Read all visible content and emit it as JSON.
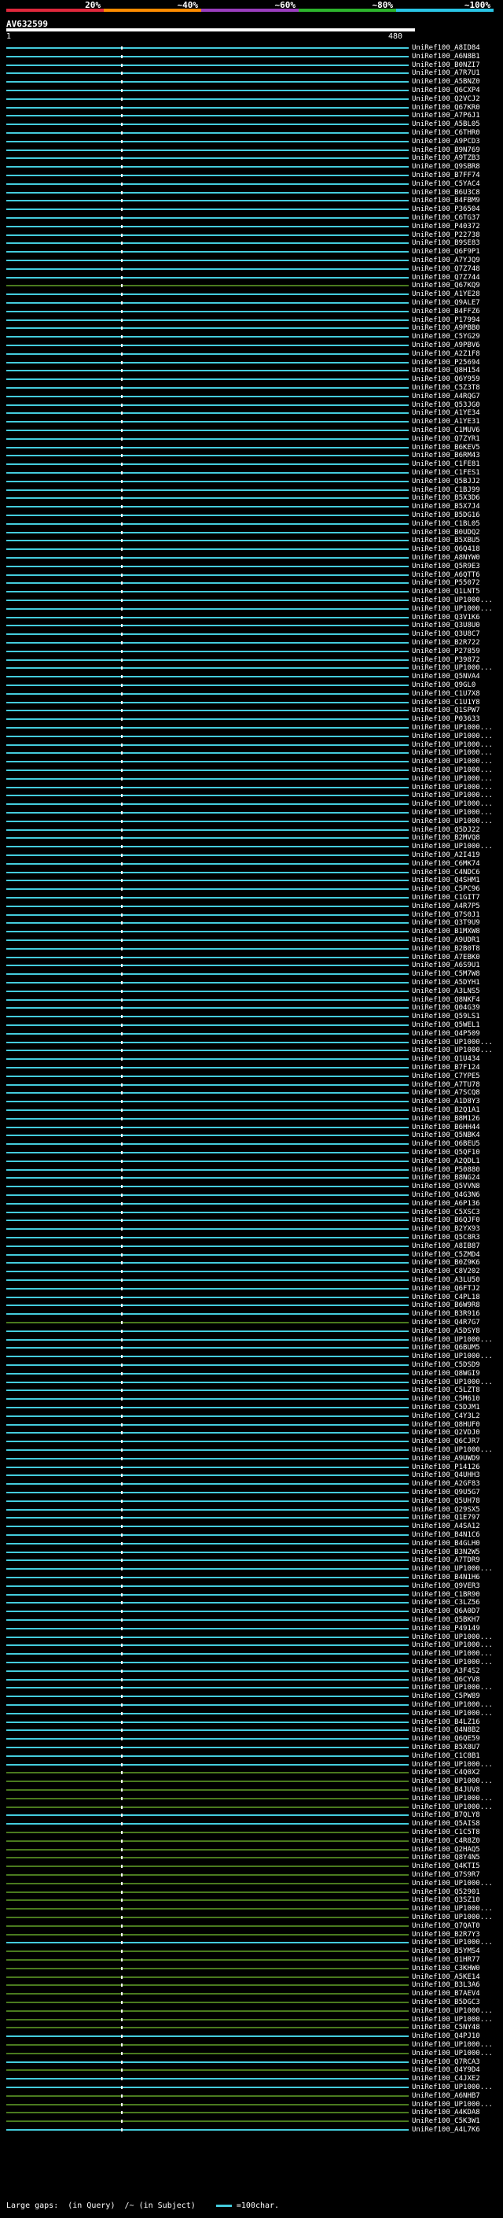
{
  "scale": {
    "ticks": [
      "20%",
      "~40%",
      "~60%",
      "~80%",
      "~100%"
    ],
    "colors": [
      "#e0283c",
      "#ff8c00",
      "#9b3ebf",
      "#2db52d",
      "#29c5e6"
    ]
  },
  "query": {
    "name": "AV632599",
    "start": "1",
    "end": "480"
  },
  "legend": {
    "large_gaps": "Large gaps:",
    "in_query": "(in Query)",
    "in_subject": "/~ (in Subject)",
    "scale_note": "=100char."
  },
  "colors": {
    "cyan": "#44ccdd",
    "green": "#4a7a1e",
    "gap": "#ffffff"
  },
  "hits": [
    {
      "label": "UniRef100_A8ID84",
      "color": "cyan"
    },
    {
      "label": "UniRef100_A6N8B1",
      "color": "cyan"
    },
    {
      "label": "UniRef100_B0NZI7",
      "color": "cyan"
    },
    {
      "label": "UniRef100_A7R7U1",
      "color": "cyan"
    },
    {
      "label": "UniRef100_A5BNZ0",
      "color": "cyan"
    },
    {
      "label": "UniRef100_Q6CXP4",
      "color": "cyan"
    },
    {
      "label": "UniRef100_Q2VCJ2",
      "color": "cyan"
    },
    {
      "label": "UniRef100_Q67KR0",
      "color": "cyan"
    },
    {
      "label": "UniRef100_A7P6J1",
      "color": "cyan"
    },
    {
      "label": "UniRef100_A5BL05",
      "color": "cyan"
    },
    {
      "label": "UniRef100_C6THR0",
      "color": "cyan"
    },
    {
      "label": "UniRef100_A9PCD3",
      "color": "cyan"
    },
    {
      "label": "UniRef100_B9N769",
      "color": "cyan"
    },
    {
      "label": "UniRef100_A9TZB3",
      "color": "cyan"
    },
    {
      "label": "UniRef100_Q9SBR8",
      "color": "cyan"
    },
    {
      "label": "UniRef100_B7FF74",
      "color": "cyan"
    },
    {
      "label": "UniRef100_C5YAC4",
      "color": "cyan"
    },
    {
      "label": "UniRef100_B6U3C8",
      "color": "cyan"
    },
    {
      "label": "UniRef100_B4FBM9",
      "color": "cyan"
    },
    {
      "label": "UniRef100_P36504",
      "color": "cyan"
    },
    {
      "label": "UniRef100_C6TG37",
      "color": "cyan"
    },
    {
      "label": "UniRef100_P40372",
      "color": "cyan"
    },
    {
      "label": "UniRef100_P22738",
      "color": "cyan"
    },
    {
      "label": "UniRef100_B9SE83",
      "color": "cyan"
    },
    {
      "label": "UniRef100_Q6F9P1",
      "color": "cyan"
    },
    {
      "label": "UniRef100_A7YJQ9",
      "color": "cyan"
    },
    {
      "label": "UniRef100_Q7Z748",
      "color": "cyan"
    },
    {
      "label": "UniRef100_Q7Z744",
      "color": "cyan"
    },
    {
      "label": "UniRef100_Q67KQ9",
      "color": "green"
    },
    {
      "label": "UniRef100_A1YE28",
      "color": "cyan"
    },
    {
      "label": "UniRef100_Q9ALE7",
      "color": "cyan"
    },
    {
      "label": "UniRef100_B4FFZ6",
      "color": "cyan"
    },
    {
      "label": "UniRef100_P17994",
      "color": "cyan"
    },
    {
      "label": "UniRef100_A9PBB0",
      "color": "cyan"
    },
    {
      "label": "UniRef100_C5YG29",
      "color": "cyan"
    },
    {
      "label": "UniRef100_A9PBV6",
      "color": "cyan"
    },
    {
      "label": "UniRef100_A2Z1F8",
      "color": "cyan"
    },
    {
      "label": "UniRef100_P25694",
      "color": "cyan"
    },
    {
      "label": "UniRef100_Q8H154",
      "color": "cyan"
    },
    {
      "label": "UniRef100_Q6Y959",
      "color": "cyan"
    },
    {
      "label": "UniRef100_C5Z3T8",
      "color": "cyan"
    },
    {
      "label": "UniRef100_A4RQG7",
      "color": "cyan"
    },
    {
      "label": "UniRef100_Q53JG0",
      "color": "cyan"
    },
    {
      "label": "UniRef100_A1YE34",
      "color": "cyan"
    },
    {
      "label": "UniRef100_A1YE31",
      "color": "cyan"
    },
    {
      "label": "UniRef100_C1MUV6",
      "color": "cyan"
    },
    {
      "label": "UniRef100_Q7ZYR1",
      "color": "cyan"
    },
    {
      "label": "UniRef100_B6KEV5",
      "color": "cyan"
    },
    {
      "label": "UniRef100_B6RM43",
      "color": "cyan"
    },
    {
      "label": "UniRef100_C1FE81",
      "color": "cyan"
    },
    {
      "label": "UniRef100_C1FES1",
      "color": "cyan"
    },
    {
      "label": "UniRef100_Q5BJJ2",
      "color": "cyan"
    },
    {
      "label": "UniRef100_C1BJ99",
      "color": "cyan"
    },
    {
      "label": "UniRef100_B5X3D6",
      "color": "cyan"
    },
    {
      "label": "UniRef100_B5X7J4",
      "color": "cyan"
    },
    {
      "label": "UniRef100_B5DG16",
      "color": "cyan"
    },
    {
      "label": "UniRef100_C1BL05",
      "color": "cyan"
    },
    {
      "label": "UniRef100_B0UDQ2",
      "color": "cyan"
    },
    {
      "label": "UniRef100_B5XBU5",
      "color": "cyan"
    },
    {
      "label": "UniRef100_Q6Q418",
      "color": "cyan"
    },
    {
      "label": "UniRef100_A8NYW0",
      "color": "cyan"
    },
    {
      "label": "UniRef100_Q5R9E3",
      "color": "cyan"
    },
    {
      "label": "UniRef100_A6QTT6",
      "color": "cyan"
    },
    {
      "label": "UniRef100_P55072",
      "color": "cyan"
    },
    {
      "label": "UniRef100_Q1LNT5",
      "color": "cyan"
    },
    {
      "label": "UniRef100_UP1000...",
      "color": "cyan"
    },
    {
      "label": "UniRef100_UP1000...",
      "color": "cyan"
    },
    {
      "label": "UniRef100_Q3V1K6",
      "color": "cyan"
    },
    {
      "label": "UniRef100_Q3U8U0",
      "color": "cyan"
    },
    {
      "label": "UniRef100_Q3U8C7",
      "color": "cyan"
    },
    {
      "label": "UniRef100_B2R722",
      "color": "cyan"
    },
    {
      "label": "UniRef100_P27859",
      "color": "cyan"
    },
    {
      "label": "UniRef100_P39872",
      "color": "cyan"
    },
    {
      "label": "UniRef100_UP1000...",
      "color": "cyan"
    },
    {
      "label": "UniRef100_Q5NVA4",
      "color": "cyan"
    },
    {
      "label": "UniRef100_Q9GL0",
      "color": "cyan"
    },
    {
      "label": "UniRef100_C1U7X8",
      "color": "cyan"
    },
    {
      "label": "UniRef100_C1U1Y8",
      "color": "cyan"
    },
    {
      "label": "UniRef100_Q1SPW7",
      "color": "cyan"
    },
    {
      "label": "UniRef100_P03633",
      "color": "cyan"
    },
    {
      "label": "UniRef100_UP1000...",
      "color": "cyan"
    },
    {
      "label": "UniRef100_UP1000...",
      "color": "cyan"
    },
    {
      "label": "UniRef100_UP1000...",
      "color": "cyan"
    },
    {
      "label": "UniRef100_UP1000...",
      "color": "cyan"
    },
    {
      "label": "UniRef100_UP1000...",
      "color": "cyan"
    },
    {
      "label": "UniRef100_UP1000...",
      "color": "cyan"
    },
    {
      "label": "UniRef100_UP1000...",
      "color": "cyan"
    },
    {
      "label": "UniRef100_UP1000...",
      "color": "cyan"
    },
    {
      "label": "UniRef100_UP1000...",
      "color": "cyan"
    },
    {
      "label": "UniRef100_UP1000...",
      "color": "cyan"
    },
    {
      "label": "UniRef100_UP1000...",
      "color": "cyan"
    },
    {
      "label": "UniRef100_UP1000...",
      "color": "cyan"
    },
    {
      "label": "UniRef100_Q5DJ22",
      "color": "cyan"
    },
    {
      "label": "UniRef100_B2MVQ8",
      "color": "cyan"
    },
    {
      "label": "UniRef100_UP1000...",
      "color": "cyan"
    },
    {
      "label": "UniRef100_A2I419",
      "color": "cyan"
    },
    {
      "label": "UniRef100_C6MK74",
      "color": "cyan"
    },
    {
      "label": "UniRef100_C4NDC6",
      "color": "cyan"
    },
    {
      "label": "UniRef100_Q4SHM1",
      "color": "cyan"
    },
    {
      "label": "UniRef100_C5PC96",
      "color": "cyan"
    },
    {
      "label": "UniRef100_C1GIT7",
      "color": "cyan"
    },
    {
      "label": "UniRef100_A4R7P5",
      "color": "cyan"
    },
    {
      "label": "UniRef100_Q7S0J1",
      "color": "cyan"
    },
    {
      "label": "UniRef100_Q3T9U9",
      "color": "cyan"
    },
    {
      "label": "UniRef100_B1MXW8",
      "color": "cyan"
    },
    {
      "label": "UniRef100_A9UDR1",
      "color": "cyan"
    },
    {
      "label": "UniRef100_B2B0T8",
      "color": "cyan"
    },
    {
      "label": "UniRef100_A7EBK0",
      "color": "cyan"
    },
    {
      "label": "UniRef100_A6S9U1",
      "color": "cyan"
    },
    {
      "label": "UniRef100_C5M7W8",
      "color": "cyan"
    },
    {
      "label": "UniRef100_A5DYH1",
      "color": "cyan"
    },
    {
      "label": "UniRef100_A3LNS5",
      "color": "cyan"
    },
    {
      "label": "UniRef100_Q8NKF4",
      "color": "cyan"
    },
    {
      "label": "UniRef100_Q04G39",
      "color": "cyan"
    },
    {
      "label": "UniRef100_Q59LS1",
      "color": "cyan"
    },
    {
      "label": "UniRef100_Q5WEL1",
      "color": "cyan"
    },
    {
      "label": "UniRef100_Q4P509",
      "color": "cyan"
    },
    {
      "label": "UniRef100_UP1000...",
      "color": "cyan"
    },
    {
      "label": "UniRef100_UP1000...",
      "color": "cyan"
    },
    {
      "label": "UniRef100_Q1U434",
      "color": "cyan"
    },
    {
      "label": "UniRef100_B7F124",
      "color": "cyan"
    },
    {
      "label": "UniRef100_C7YPE5",
      "color": "cyan"
    },
    {
      "label": "UniRef100_A7TU78",
      "color": "cyan"
    },
    {
      "label": "UniRef100_A7SCQ8",
      "color": "cyan"
    },
    {
      "label": "UniRef100_A1D8Y3",
      "color": "cyan"
    },
    {
      "label": "UniRef100_B2Q1A1",
      "color": "cyan"
    },
    {
      "label": "UniRef100_B8M126",
      "color": "cyan"
    },
    {
      "label": "UniRef100_B6HH44",
      "color": "cyan"
    },
    {
      "label": "UniRef100_Q5NBK4",
      "color": "cyan"
    },
    {
      "label": "UniRef100_Q6BEU5",
      "color": "cyan"
    },
    {
      "label": "UniRef100_Q5QF10",
      "color": "cyan"
    },
    {
      "label": "UniRef100_A2QDL1",
      "color": "cyan"
    },
    {
      "label": "UniRef100_P50880",
      "color": "cyan"
    },
    {
      "label": "UniRef100_B8NG24",
      "color": "cyan"
    },
    {
      "label": "UniRef100_Q5VVN8",
      "color": "cyan"
    },
    {
      "label": "UniRef100_Q4G3N6",
      "color": "cyan"
    },
    {
      "label": "UniRef100_A6P136",
      "color": "cyan"
    },
    {
      "label": "UniRef100_C5XSC3",
      "color": "cyan"
    },
    {
      "label": "UniRef100_B6QJF0",
      "color": "cyan"
    },
    {
      "label": "UniRef100_B2YX93",
      "color": "cyan"
    },
    {
      "label": "UniRef100_Q5C8R3",
      "color": "cyan"
    },
    {
      "label": "UniRef100_A8IB87",
      "color": "cyan"
    },
    {
      "label": "UniRef100_C5ZMD4",
      "color": "cyan"
    },
    {
      "label": "UniRef100_B0Z9K6",
      "color": "cyan"
    },
    {
      "label": "UniRef100_C8V202",
      "color": "cyan"
    },
    {
      "label": "UniRef100_A3LU50",
      "color": "cyan"
    },
    {
      "label": "UniRef100_Q6FTJ2",
      "color": "cyan"
    },
    {
      "label": "UniRef100_C4PL18",
      "color": "cyan"
    },
    {
      "label": "UniRef100_B6W9R8",
      "color": "cyan"
    },
    {
      "label": "UniRef100_B3R916",
      "color": "cyan"
    },
    {
      "label": "UniRef100_Q4R7G7",
      "color": "green"
    },
    {
      "label": "UniRef100_A5DSY8",
      "color": "cyan"
    },
    {
      "label": "UniRef100_UP1000...",
      "color": "cyan"
    },
    {
      "label": "UniRef100_Q6BUM5",
      "color": "cyan"
    },
    {
      "label": "UniRef100_UP1000...",
      "color": "cyan"
    },
    {
      "label": "UniRef100_C5DSD9",
      "color": "cyan"
    },
    {
      "label": "UniRef100_Q8WGI9",
      "color": "cyan"
    },
    {
      "label": "UniRef100_UP1000...",
      "color": "cyan"
    },
    {
      "label": "UniRef100_C5LZT8",
      "color": "cyan"
    },
    {
      "label": "UniRef100_C5M610",
      "color": "cyan"
    },
    {
      "label": "UniRef100_C5DJM1",
      "color": "cyan"
    },
    {
      "label": "UniRef100_C4Y3L2",
      "color": "cyan"
    },
    {
      "label": "UniRef100_Q8HUF0",
      "color": "cyan"
    },
    {
      "label": "UniRef100_Q2VDJ0",
      "color": "cyan"
    },
    {
      "label": "UniRef100_Q6CJR7",
      "color": "cyan"
    },
    {
      "label": "UniRef100_UP1000...",
      "color": "cyan"
    },
    {
      "label": "UniRef100_A9UWD9",
      "color": "cyan"
    },
    {
      "label": "UniRef100_P14126",
      "color": "cyan"
    },
    {
      "label": "UniRef100_Q4UHH3",
      "color": "cyan"
    },
    {
      "label": "UniRef100_A2GF83",
      "color": "cyan"
    },
    {
      "label": "UniRef100_Q9U5G7",
      "color": "cyan"
    },
    {
      "label": "UniRef100_Q5UH78",
      "color": "cyan"
    },
    {
      "label": "UniRef100_Q29SX5",
      "color": "cyan"
    },
    {
      "label": "UniRef100_Q1E797",
      "color": "cyan"
    },
    {
      "label": "UniRef100_A4SA12",
      "color": "cyan"
    },
    {
      "label": "UniRef100_B4N1C6",
      "color": "cyan"
    },
    {
      "label": "UniRef100_B4GLH0",
      "color": "cyan"
    },
    {
      "label": "UniRef100_B3N2W5",
      "color": "cyan"
    },
    {
      "label": "UniRef100_A7TDR9",
      "color": "cyan"
    },
    {
      "label": "UniRef100_UP1000...",
      "color": "cyan"
    },
    {
      "label": "UniRef100_B4N1H6",
      "color": "cyan"
    },
    {
      "label": "UniRef100_Q9VER3",
      "color": "cyan"
    },
    {
      "label": "UniRef100_C1BR90",
      "color": "cyan"
    },
    {
      "label": "UniRef100_C3LZ56",
      "color": "cyan"
    },
    {
      "label": "UniRef100_Q6A0D7",
      "color": "cyan"
    },
    {
      "label": "UniRef100_Q5BKH7",
      "color": "cyan"
    },
    {
      "label": "UniRef100_P49149",
      "color": "cyan"
    },
    {
      "label": "UniRef100_UP1000...",
      "color": "cyan"
    },
    {
      "label": "UniRef100_UP1000...",
      "color": "cyan"
    },
    {
      "label": "UniRef100_UP1000...",
      "color": "cyan"
    },
    {
      "label": "UniRef100_UP1000...",
      "color": "cyan"
    },
    {
      "label": "UniRef100_A3F4S2",
      "color": "cyan"
    },
    {
      "label": "UniRef100_Q6CYV8",
      "color": "cyan"
    },
    {
      "label": "UniRef100_UP1000...",
      "color": "cyan"
    },
    {
      "label": "UniRef100_C5PW89",
      "color": "cyan"
    },
    {
      "label": "UniRef100_UP1000...",
      "color": "cyan"
    },
    {
      "label": "UniRef100_UP1000...",
      "color": "cyan"
    },
    {
      "label": "UniRef100_B4LZ16",
      "color": "cyan"
    },
    {
      "label": "UniRef100_Q4N8B2",
      "color": "cyan"
    },
    {
      "label": "UniRef100_Q6QE59",
      "color": "cyan"
    },
    {
      "label": "UniRef100_B5X8U7",
      "color": "cyan"
    },
    {
      "label": "UniRef100_C1C8B1",
      "color": "cyan"
    },
    {
      "label": "UniRef100_UP1000...",
      "color": "cyan"
    },
    {
      "label": "UniRef100_C4Q0X2",
      "color": "green"
    },
    {
      "label": "UniRef100_UP1000...",
      "color": "green"
    },
    {
      "label": "UniRef100_B4JUV8",
      "color": "green"
    },
    {
      "label": "UniRef100_UP1000...",
      "color": "green"
    },
    {
      "label": "UniRef100_UP1000...",
      "color": "green"
    },
    {
      "label": "UniRef100_B7QLY8",
      "color": "cyan"
    },
    {
      "label": "UniRef100_Q5AIS8",
      "color": "cyan"
    },
    {
      "label": "UniRef100_C1C5T8",
      "color": "green"
    },
    {
      "label": "UniRef100_C4R8Z0",
      "color": "green"
    },
    {
      "label": "UniRef100_Q2HAQ5",
      "color": "green"
    },
    {
      "label": "UniRef100_Q8Y4N5",
      "color": "green"
    },
    {
      "label": "UniRef100_Q4KTI5",
      "color": "green"
    },
    {
      "label": "UniRef100_Q7S9R7",
      "color": "green"
    },
    {
      "label": "UniRef100_UP1000...",
      "color": "green"
    },
    {
      "label": "UniRef100_Q52901",
      "color": "green"
    },
    {
      "label": "UniRef100_Q3SZ10",
      "color": "green"
    },
    {
      "label": "UniRef100_UP1000...",
      "color": "green"
    },
    {
      "label": "UniRef100_UP1000...",
      "color": "green"
    },
    {
      "label": "UniRef100_Q7QAT0",
      "color": "green"
    },
    {
      "label": "UniRef100_B2R7Y3",
      "color": "green"
    },
    {
      "label": "UniRef100_UP1000...",
      "color": "cyan"
    },
    {
      "label": "UniRef100_B5YMS4",
      "color": "green"
    },
    {
      "label": "UniRef100_Q1HR77",
      "color": "green"
    },
    {
      "label": "UniRef100_C3KHW0",
      "color": "green"
    },
    {
      "label": "UniRef100_A5KE14",
      "color": "green"
    },
    {
      "label": "UniRef100_B3L3A6",
      "color": "green"
    },
    {
      "label": "UniRef100_B7AEV4",
      "color": "green"
    },
    {
      "label": "UniRef100_B5DGC3",
      "color": "green"
    },
    {
      "label": "UniRef100_UP1000...",
      "color": "green"
    },
    {
      "label": "UniRef100_UP1000...",
      "color": "green"
    },
    {
      "label": "UniRef100_C5NY48",
      "color": "green"
    },
    {
      "label": "UniRef100_Q4PJ10",
      "color": "cyan"
    },
    {
      "label": "UniRef100_UP1000...",
      "color": "green"
    },
    {
      "label": "UniRef100_UP1000...",
      "color": "green"
    },
    {
      "label": "UniRef100_Q7RCA3",
      "color": "cyan"
    },
    {
      "label": "UniRef100_Q4Y9D4",
      "color": "green"
    },
    {
      "label": "UniRef100_C4JXE2",
      "color": "cyan"
    },
    {
      "label": "UniRef100_UP1000...",
      "color": "cyan"
    },
    {
      "label": "UniRef100_A6NHB7",
      "color": "green"
    },
    {
      "label": "UniRef100_UP1000...",
      "color": "green"
    },
    {
      "label": "UniRef100_A4KDA8",
      "color": "green"
    },
    {
      "label": "UniRef100_C5K3W1",
      "color": "green"
    },
    {
      "label": "UniRef100_A4L7K6",
      "color": "cyan"
    }
  ]
}
